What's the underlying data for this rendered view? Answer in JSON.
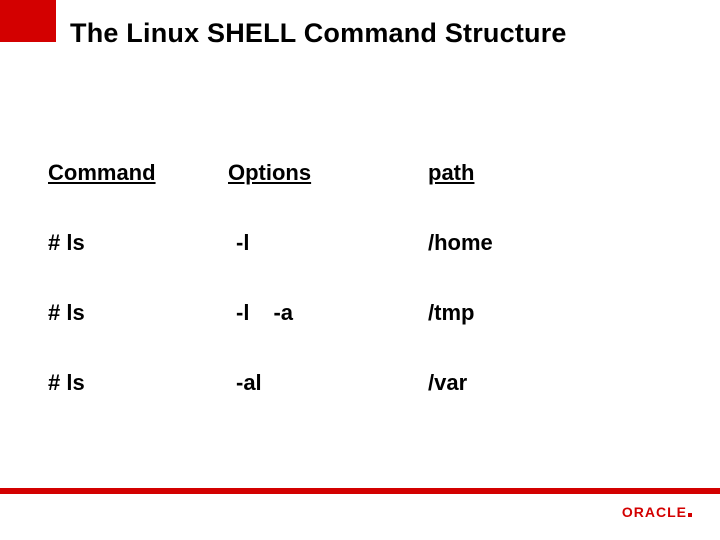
{
  "title": "The Linux SHELL Command Structure",
  "headers": {
    "command": "Command",
    "options": "Options",
    "path": "path"
  },
  "rows": [
    {
      "command": "#  ls",
      "opt1": "-l",
      "opt2": "",
      "path": "/home"
    },
    {
      "command": "#  ls",
      "opt1": "-l",
      "opt2": "-a",
      "path": "/tmp"
    },
    {
      "command": "#  ls",
      "opt1": "-al",
      "opt2": "",
      "path": "/var"
    }
  ],
  "logo": "ORACLE"
}
